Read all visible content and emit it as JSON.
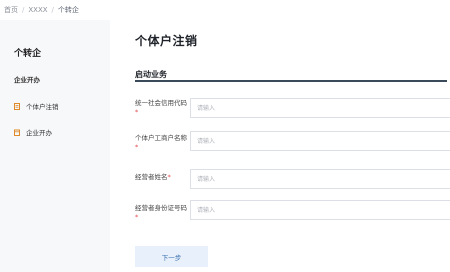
{
  "breadcrumb": {
    "items": [
      "首页",
      "XXXX",
      "个转企"
    ]
  },
  "sidebar": {
    "title": "个转企",
    "group_label": "企业开办",
    "items": [
      {
        "label": "个体户注销",
        "icon": "document-icon"
      },
      {
        "label": "企业开办",
        "icon": "calendar-icon"
      }
    ]
  },
  "main": {
    "page_title": "个体户注销",
    "section_title": "启动业务",
    "fields": [
      {
        "label": "统一社会信用代码",
        "required": "*",
        "placeholder": "请输入"
      },
      {
        "label": "个体户工商户名称",
        "required": "*",
        "placeholder": "请输入"
      },
      {
        "label": "经营者姓名",
        "required": "*",
        "placeholder": "请输入"
      },
      {
        "label": "经营者身份证号码",
        "required": "*",
        "placeholder": "请输入"
      }
    ],
    "next_button": "下一步"
  },
  "colors": {
    "required": "#e5484d",
    "section_line": "#3a4a5a",
    "button_bg": "#e8f1fb",
    "button_text": "#3a6fb0",
    "sidebar_bg": "#f7f8fa"
  }
}
